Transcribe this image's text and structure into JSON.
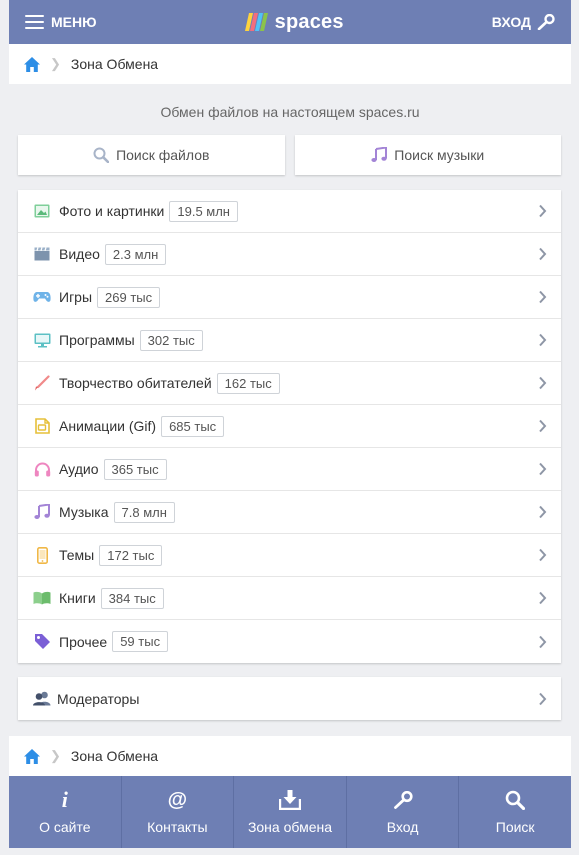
{
  "header": {
    "menu_label": "МЕНЮ",
    "logo_text": "spaces",
    "login_label": "ВХОД"
  },
  "breadcrumb": {
    "label": "Зона Обмена"
  },
  "subtitle": "Обмен файлов на настоящем spaces.ru",
  "search": {
    "files_label": "Поиск файлов",
    "music_label": "Поиск музыки"
  },
  "categories": [
    {
      "label": "Фото и картинки",
      "count": "19.5 млн",
      "icon": "photo-icon"
    },
    {
      "label": "Видео",
      "count": "2.3 млн",
      "icon": "video-icon"
    },
    {
      "label": "Игры",
      "count": "269 тыс",
      "icon": "gamepad-icon"
    },
    {
      "label": "Программы",
      "count": "302 тыс",
      "icon": "monitor-icon"
    },
    {
      "label": "Творчество обитателей",
      "count": "162 тыс",
      "icon": "brush-icon"
    },
    {
      "label": "Анимации (Gif)",
      "count": "685 тыс",
      "icon": "gif-icon"
    },
    {
      "label": "Аудио",
      "count": "365 тыс",
      "icon": "headphones-icon"
    },
    {
      "label": "Музыка",
      "count": "7.8 млн",
      "icon": "music-note-icon"
    },
    {
      "label": "Темы",
      "count": "172 тыс",
      "icon": "phone-icon"
    },
    {
      "label": "Книги",
      "count": "384 тыс",
      "icon": "book-icon"
    },
    {
      "label": "Прочее",
      "count": "59 тыс",
      "icon": "tag-icon"
    }
  ],
  "moderators": {
    "label": "Модераторы",
    "icon": "users-icon"
  },
  "bottom_nav": [
    {
      "label": "О сайте",
      "icon": "info-icon"
    },
    {
      "label": "Контакты",
      "icon": "at-icon"
    },
    {
      "label": "Зона обмена",
      "icon": "download-icon"
    },
    {
      "label": "Вход",
      "icon": "key-icon"
    },
    {
      "label": "Поиск",
      "icon": "search-icon"
    }
  ],
  "colors": {
    "header_bg": "#6e7fb4",
    "page_bg": "#eeeff2",
    "home_icon": "#2d8ee6"
  }
}
